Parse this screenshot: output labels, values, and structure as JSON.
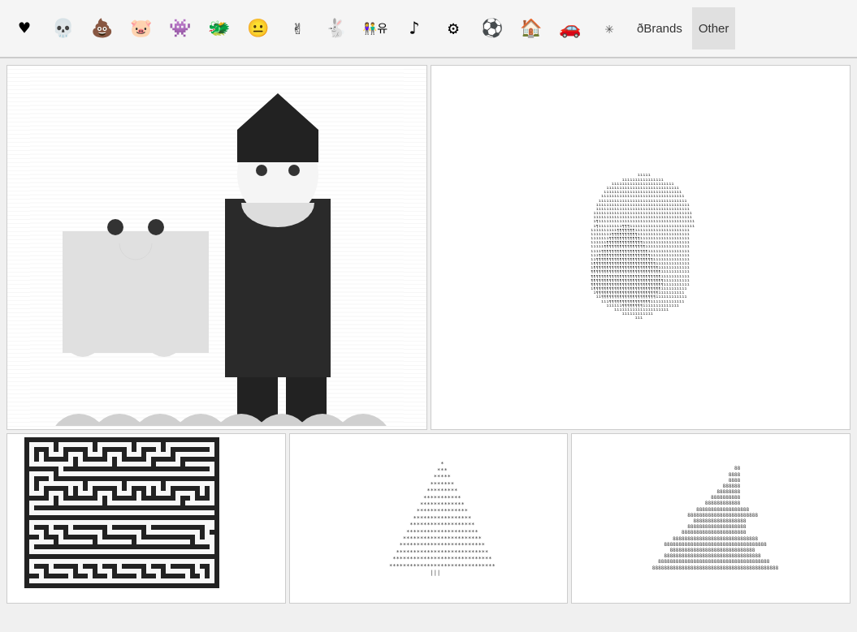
{
  "navbar": {
    "items": [
      {
        "id": "heart",
        "emoji": "♥",
        "label": "Heart"
      },
      {
        "id": "skull",
        "emoji": "💀",
        "label": "Skull"
      },
      {
        "id": "poop",
        "emoji": "💩",
        "label": "Poop"
      },
      {
        "id": "pig",
        "emoji": "🐷",
        "label": "Pig"
      },
      {
        "id": "monster",
        "emoji": "👾",
        "label": "Monster"
      },
      {
        "id": "dragon",
        "emoji": "🐲",
        "label": "Dragon"
      },
      {
        "id": "smiley",
        "emoji": "😐",
        "label": "Smiley"
      },
      {
        "id": "peace",
        "emoji": "✌",
        "label": "Peace"
      },
      {
        "id": "rabbit",
        "emoji": "🐇",
        "label": "Rabbit"
      },
      {
        "id": "people",
        "emoji": "👫",
        "label": "People"
      },
      {
        "id": "music",
        "emoji": "♪",
        "label": "Music"
      },
      {
        "id": "gear",
        "emoji": "⚙",
        "label": "Gear"
      },
      {
        "id": "soccer",
        "emoji": "⚽",
        "label": "Soccer"
      },
      {
        "id": "house",
        "emoji": "🏠",
        "label": "House"
      },
      {
        "id": "car",
        "emoji": "🚗",
        "label": "Car"
      },
      {
        "id": "snowflake",
        "emoji": "✳",
        "label": "Snowflake"
      },
      {
        "id": "brands",
        "text": "ðBrands",
        "label": "Brands"
      },
      {
        "id": "other",
        "text": "Other",
        "label": "Other",
        "active": true
      }
    ]
  },
  "panels": {
    "top_left": {
      "label": "Santa and Ghost",
      "type": "santa-ghost"
    },
    "top_right": {
      "label": "Soccer Ball",
      "type": "soccer-ball"
    },
    "bottom_left": {
      "label": "Maze",
      "type": "maze"
    },
    "bottom_middle": {
      "label": "Christmas Tree",
      "type": "tree"
    },
    "bottom_right": {
      "label": "Tree of Eights",
      "type": "eights"
    }
  },
  "soccer_art": "                    11111\n              1111111111111111\n          111111111111111111111111\n        1111111111111111111111111111\n       111111111111111111111111111111\n      11111111111111111111111111111111\n     1111111111111111111111111111111111\n    111111111111111111111111111111111111\n    111111111111111111111111111111111111\n   11111111111111111111111111111111111111\n   11111111111111111111111111111111111111\n   1¶1111111111111111111111111111111111111\n   1¶111111111¶¶¶1111111111111111111111111\n  1111111111¶¶¶¶¶¶¶111111111111111111111\n  11111111¶¶¶¶¶¶¶¶¶¶11111111111111111111\n  1111111¶¶¶¶¶¶¶¶¶¶¶¶1111111111111111111\n  111111¶¶¶¶¶¶¶¶¶¶¶¶¶¶111111111111111111\n  11111¶¶¶¶¶¶¶¶¶¶¶¶¶¶¶¶11111111111111111\n  1111¶¶¶¶¶¶¶¶¶¶¶¶¶¶¶¶¶¶1111111111111111\n  111¶¶¶¶¶¶¶¶¶¶¶¶¶¶¶¶¶¶¶¶111111111111111\n  11¶¶¶¶¶¶¶¶¶¶¶¶¶¶¶¶¶¶¶¶¶¶11111111111111\n  1¶¶¶¶¶¶¶¶¶¶¶¶¶¶¶¶¶¶¶¶¶¶¶¶1111111111111\n  1¶¶¶¶¶¶¶¶¶¶¶¶¶¶¶¶¶¶¶¶¶¶¶¶¶111111111111\n  ¶¶¶¶¶¶¶¶¶¶¶¶¶¶¶¶¶¶¶¶¶¶¶¶¶¶¶11111111111\n  ¶¶¶¶¶¶¶¶¶¶¶¶¶¶¶¶¶¶¶¶¶¶¶¶¶¶¶11111111111\n  ¶¶¶¶¶¶¶¶¶¶¶¶¶¶¶¶¶¶¶¶¶¶¶¶¶¶¶¶1111111111\n  ¶¶¶¶¶¶¶¶¶¶¶¶¶¶¶¶¶¶¶¶¶¶¶¶¶¶¶¶1111111111\n  1¶¶¶¶¶¶¶¶¶¶¶¶¶¶¶¶¶¶¶¶¶¶¶¶¶¶1111111111\n   1¶¶¶¶¶¶¶¶¶¶¶¶¶¶¶¶¶¶¶¶¶¶¶¶1111111111\n    11¶¶¶¶¶¶¶¶¶¶¶¶¶¶¶¶¶¶¶¶¶111111111111\n      111¶¶¶¶¶¶¶¶¶¶¶¶¶¶¶¶1111111111111\n        111111¶¶¶¶¶¶¶¶11111111111111\n           111111111111111111111\n              111111111111\n                   111",
  "eights_art": "                               88\n                             8888\n                             8888\n                           888888\n                         88888888\n                       8888888888\n                     888888888888\n                  888888888888888888\n               888888888888888888888888\n                 888888888888888888\n               88888888888888888888\n             8888888888888888888888\n          88888888888888888888888888888\n       88888888888888888888888888888888888\n         88888888888888888888888888888\n       888888888888888888888888888888888\n     88888888888888888888888888888888888888\n   8888888888888888888888888888888888888888888",
  "tree_art": "                       *\n                      ***\n                     *****\n                    *******\n                   *********\n                  ***********\n                 *************\n                ***************\n               *****************\n              *******************\n             *********************\n            ***********************\n           *************************\n          ***************************\n         *****************************\n        *******************************\n                    |||",
  "brands_label": "ðBrands",
  "other_label": "Other"
}
